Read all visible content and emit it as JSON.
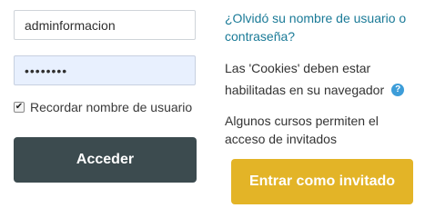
{
  "login": {
    "username_value": "adminformacion",
    "password_value": "••••••••",
    "remember_checked": "✔",
    "remember_label": "Recordar nombre de usuario",
    "submit_label": "Acceder"
  },
  "info": {
    "forgot_link": "¿Olvidó su nombre de usuario o contraseña?",
    "cookies_text": "Las 'Cookies' deben estar habilitadas en su navegador",
    "help_icon": "?",
    "guest_text": "Algunos cursos permiten el acceso de invitados",
    "guest_button": "Entrar como invitado"
  },
  "colors": {
    "login_button": "#3c4b4f",
    "guest_button": "#e3b427",
    "link": "#1a7a97",
    "help_icon": "#3d9dd9"
  }
}
